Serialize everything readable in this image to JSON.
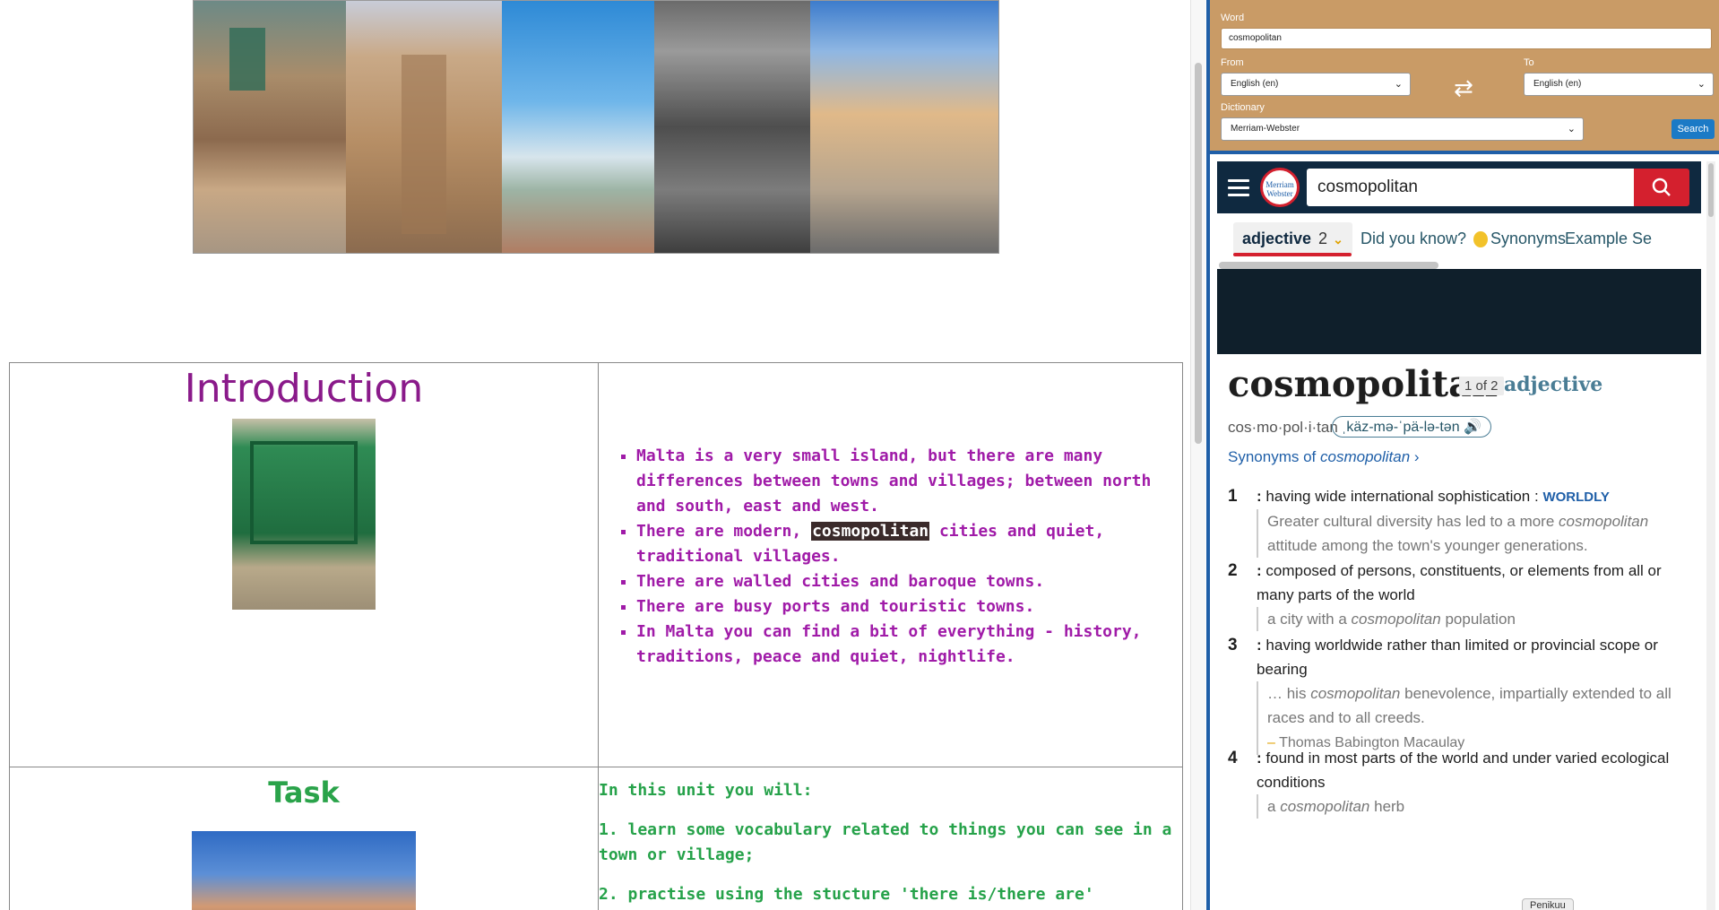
{
  "left_page": {
    "intro": {
      "title": "Introduction",
      "bullets": [
        "Malta is a very small island, but there are many differences between  towns and villages; between north and south, east and west.",
        "cities and quiet, traditional villages.",
        "There are walled cities and baroque towns.",
        "There are busy ports and touristic towns.",
        "In Malta you can find a bit of everything - history, traditions, peace and quiet, nightlife."
      ],
      "bullet2_prefix": "There are modern,",
      "bullet2_highlight": "cosmopolitan"
    },
    "task": {
      "title": "Task",
      "lines": [
        "In this unit you will:",
        "1. learn some vocabulary related to things you can see in a town or village;",
        "2. practise using the stucture 'there is/there are'"
      ]
    }
  },
  "translator_panel": {
    "word_label": "Word",
    "word_value": "cosmopolitan",
    "from_label": "From",
    "from_value": "English (en)",
    "to_label": "To",
    "to_value": "English (en)",
    "dictionary_label": "Dictionary",
    "dictionary_value": "Merriam-Webster",
    "search_label": "Search"
  },
  "dictionary": {
    "logo_text": "Merriam Webster",
    "search_value": "cosmopolitan",
    "tabs": {
      "adjective": "adjective",
      "adjective_count": "2",
      "did_you_know": "Did you know?",
      "synonyms": "Synonyms",
      "examples": "Example Se"
    },
    "headword": "cosmopolitan",
    "entry_index": "1 of 2",
    "part_of_speech": "adjective",
    "syllables": "cos·​mo·​pol·​i·​tan",
    "pronunciation": "ˌkäz-mə-ˈpä-lə-tən",
    "synonyms_link_prefix": "Synonyms of",
    "synonyms_link_word": "cosmopolitan",
    "senses": [
      {
        "num": "1",
        "def": "having wide international sophistication :",
        "xref": "WORLDLY",
        "ex_a": "Greater cultural diversity has led to a more",
        "ex_word": "cosmopolitan",
        "ex_b": "attitude among the town's younger generations."
      },
      {
        "num": "2",
        "def": "composed of persons, constituents, or elements from all or many parts of the world",
        "ex_a": "a city with a",
        "ex_word": "cosmopolitan",
        "ex_b": "population"
      },
      {
        "num": "3",
        "def": "having worldwide rather than limited or provincial scope or bearing",
        "ex_a": "… his",
        "ex_word": "cosmopolitan",
        "ex_b": "benevolence, impartially extended to all races and to all creeds.",
        "attribution": "Thomas Babington Macaulay"
      },
      {
        "num": "4",
        "def": "found in most parts of the world and under varied ecological conditions",
        "ex_a": "a",
        "ex_word": "cosmopolitan",
        "ex_b": "herb"
      }
    ],
    "peek_label": "Penikuu"
  },
  "colors": {
    "intro_purple": "#a01ba8",
    "task_green": "#26a24a",
    "panel_tan": "#c99b66",
    "mw_navy": "#0f2940",
    "mw_red": "#d4202e"
  }
}
